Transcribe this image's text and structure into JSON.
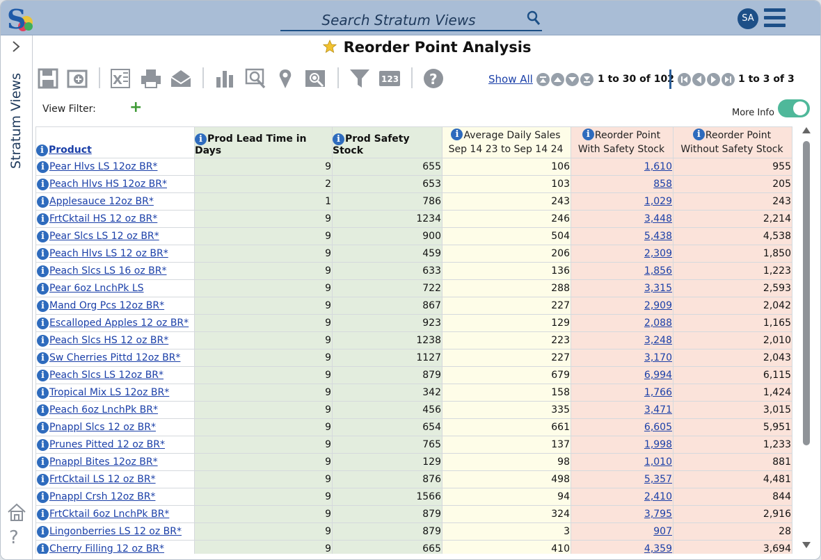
{
  "search": {
    "placeholder": "Search Stratum Views"
  },
  "user": {
    "initials": "SA"
  },
  "sidebar": {
    "label": "Stratum Views"
  },
  "page": {
    "title": "Reorder Point Analysis"
  },
  "toolbar": {
    "icons": [
      "save-icon",
      "add-view-icon",
      "excel-export-icon",
      "print-icon",
      "email-icon",
      "chart-icon",
      "drill-icon",
      "map-pin-icon",
      "search-zoom-icon",
      "filter-icon",
      "number-format-icon",
      "help-icon"
    ],
    "show_all_label": "Show All",
    "pager_label": "1 to 30 of 102",
    "pager2_label": "1 to 3 of 3"
  },
  "filter": {
    "view_filter_label": "View Filter:",
    "add_label": "+",
    "more_info_label": "More Info",
    "more_info_on": true
  },
  "colors": {
    "topbar": "#a9bdd6",
    "accent": "#1d4f87",
    "link": "#1a3fa8",
    "toggle": "#4fb89a"
  },
  "table": {
    "headers": {
      "product": "Product",
      "lead_time": "Prod Lead Time in Days",
      "safety_stock": "Prod Safety Stock",
      "ads_line1": "Average Daily Sales",
      "ads_line2": "Sep 14 23 to Sep 14 24",
      "rpw_line1": "Reorder Point",
      "rpw_line2": "With Safety Stock",
      "rpwo_line1": "Reorder Point",
      "rpwo_line2": "Without Safety Stock"
    },
    "rows": [
      {
        "product": "Pear Hlvs LS 12oz BR*",
        "lead": "9",
        "safety": "655",
        "ads": "106",
        "rpw": "1,610",
        "rpwo": "955"
      },
      {
        "product": "Peach Hlvs HS 12oz BR*",
        "lead": "2",
        "safety": "653",
        "ads": "103",
        "rpw": "858",
        "rpwo": "205"
      },
      {
        "product": "Applesauce 12oz BR*",
        "lead": "1",
        "safety": "786",
        "ads": "243",
        "rpw": "1,029",
        "rpwo": "243"
      },
      {
        "product": "FrtCktail HS 12 oz BR*",
        "lead": "9",
        "safety": "1234",
        "ads": "246",
        "rpw": "3,448",
        "rpwo": "2,214"
      },
      {
        "product": "Pear Slcs LS 12 oz BR*",
        "lead": "9",
        "safety": "900",
        "ads": "504",
        "rpw": "5,438",
        "rpwo": "4,538"
      },
      {
        "product": "Peach Hlvs LS 12 oz BR*",
        "lead": "9",
        "safety": "459",
        "ads": "206",
        "rpw": "2,309",
        "rpwo": "1,850"
      },
      {
        "product": "Peach Slcs LS 16 oz BR*",
        "lead": "9",
        "safety": "633",
        "ads": "136",
        "rpw": "1,856",
        "rpwo": "1,223"
      },
      {
        "product": "Pear 6oz LnchPk LS",
        "lead": "9",
        "safety": "722",
        "ads": "288",
        "rpw": "3,315",
        "rpwo": "2,593"
      },
      {
        "product": "Mand Org Pcs 12oz BR*",
        "lead": "9",
        "safety": "867",
        "ads": "227",
        "rpw": "2,909",
        "rpwo": "2,042"
      },
      {
        "product": "Escalloped Apples 12 oz BR*",
        "lead": "9",
        "safety": "923",
        "ads": "129",
        "rpw": "2,088",
        "rpwo": "1,165"
      },
      {
        "product": "Peach Slcs HS 12 oz BR*",
        "lead": "9",
        "safety": "1238",
        "ads": "223",
        "rpw": "3,248",
        "rpwo": "2,010"
      },
      {
        "product": "Sw Cherries Pittd 12oz BR*",
        "lead": "9",
        "safety": "1127",
        "ads": "227",
        "rpw": "3,170",
        "rpwo": "2,043"
      },
      {
        "product": "Peach Slcs LS 12oz BR*",
        "lead": "9",
        "safety": "879",
        "ads": "679",
        "rpw": "6,994",
        "rpwo": "6,115"
      },
      {
        "product": "Tropical Mix LS 12oz BR*",
        "lead": "9",
        "safety": "342",
        "ads": "158",
        "rpw": "1,766",
        "rpwo": "1,424"
      },
      {
        "product": "Peach 6oz LnchPk BR*",
        "lead": "9",
        "safety": "456",
        "ads": "335",
        "rpw": "3,471",
        "rpwo": "3,015"
      },
      {
        "product": "Pnappl Slcs 12 oz BR*",
        "lead": "9",
        "safety": "654",
        "ads": "661",
        "rpw": "6,605",
        "rpwo": "5,951"
      },
      {
        "product": "Prunes Pitted 12 oz BR*",
        "lead": "9",
        "safety": "765",
        "ads": "137",
        "rpw": "1,998",
        "rpwo": "1,233"
      },
      {
        "product": "Pnappl Bites 12oz BR*",
        "lead": "9",
        "safety": "129",
        "ads": "98",
        "rpw": "1,010",
        "rpwo": "881"
      },
      {
        "product": "FrtCktail LS 12 oz BR*",
        "lead": "9",
        "safety": "876",
        "ads": "498",
        "rpw": "5,357",
        "rpwo": "4,481"
      },
      {
        "product": "Pnappl Crsh 12oz BR*",
        "lead": "9",
        "safety": "1566",
        "ads": "94",
        "rpw": "2,410",
        "rpwo": "844"
      },
      {
        "product": "FrtCktail 6oz LnchPk BR*",
        "lead": "9",
        "safety": "879",
        "ads": "324",
        "rpw": "3,795",
        "rpwo": "2,916"
      },
      {
        "product": "Lingonberries LS 12 oz BR*",
        "lead": "9",
        "safety": "879",
        "ads": "3",
        "rpw": "907",
        "rpwo": "28"
      },
      {
        "product": "Cherry Filling 12 oz BR*",
        "lead": "9",
        "safety": "665",
        "ads": "410",
        "rpw": "4,359",
        "rpwo": "3,694"
      }
    ]
  }
}
